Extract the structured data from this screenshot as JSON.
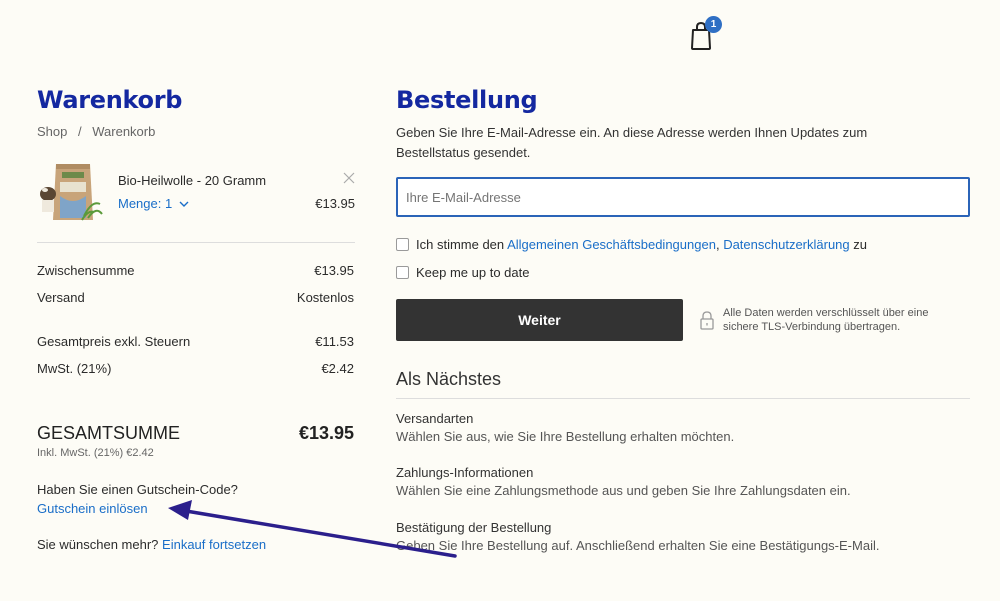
{
  "header": {
    "cart_count": "1"
  },
  "cart": {
    "title": "Warenkorb",
    "breadcrumb": {
      "shop": "Shop",
      "sep": "/",
      "current": "Warenkorb"
    },
    "item": {
      "name": "Bio-Heilwolle - 20 Gramm",
      "quantity_label": "Menge: 1",
      "price": "€13.95"
    },
    "summary": {
      "subtotal_label": "Zwischensumme",
      "subtotal_value": "€13.95",
      "shipping_label": "Versand",
      "shipping_value": "Kostenlos",
      "net_label": "Gesamtpreis exkl. Steuern",
      "net_value": "€11.53",
      "vat_label": "MwSt. (21%)",
      "vat_value": "€2.42",
      "total_label": "GESAMTSUMME",
      "total_value": "€13.95",
      "total_note": "Inkl. MwSt. (21%) €2.42"
    },
    "voucher_question": "Haben Sie einen Gutschein-Code?",
    "voucher_link": "Gutschein einlösen",
    "more_text": "Sie wünschen mehr?",
    "continue_link": "Einkauf fortsetzen"
  },
  "order": {
    "title": "Bestellung",
    "intro": "Geben Sie Ihre E-Mail-Adresse ein. An diese Adresse werden Ihnen Updates zum Bestellstatus gesendet.",
    "email_placeholder": "Ihre E-Mail-Adresse",
    "terms_prefix": "Ich stimme den",
    "terms_link": "Allgemeinen Geschäftsbedingungen",
    "terms_comma": ",",
    "privacy_link": "Datenschutzerklärung",
    "terms_suffix": "zu",
    "newsletter_label": "Keep me up to date",
    "submit_label": "Weiter",
    "secure_note": "Alle Daten werden verschlüsselt über eine sichere TLS-Verbindung übertragen.",
    "next_title": "Als Nächstes",
    "steps": [
      {
        "title": "Versandarten",
        "desc": "Wählen Sie aus, wie Sie Ihre Bestellung erhalten möchten."
      },
      {
        "title": "Zahlungs-Informationen",
        "desc": "Wählen Sie eine Zahlungsmethode aus und geben Sie Ihre Zahlungsdaten ein."
      },
      {
        "title": "Bestätigung der Bestellung",
        "desc": "Geben Sie Ihre Bestellung auf. Anschließend erhalten Sie eine Bestätigungs-E-Mail."
      }
    ]
  },
  "colors": {
    "brand": "#1428a0",
    "link": "#1a6ec8",
    "button": "#333333",
    "annotation": "#2b1f8c"
  }
}
